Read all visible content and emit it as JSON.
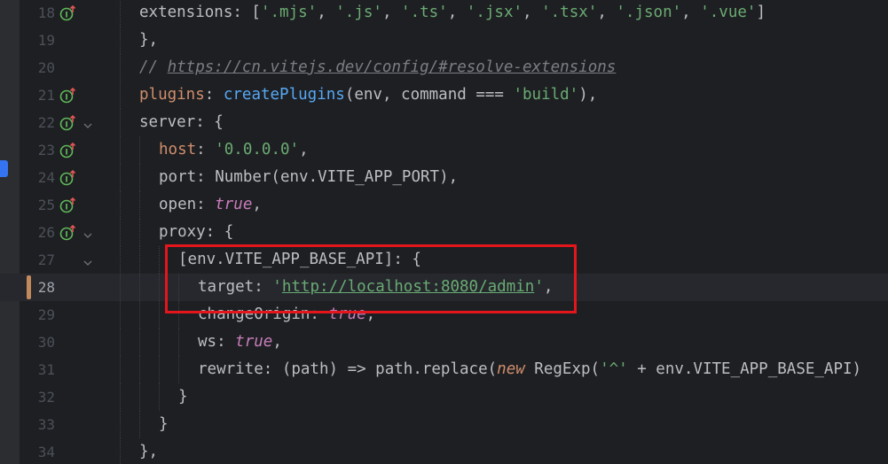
{
  "editor": {
    "lines": [
      {
        "num": "18",
        "gutter_icon": "implements-override-icon",
        "fold": false,
        "tokens": [
          {
            "t": "extensions: [",
            "c": ""
          },
          {
            "t": "'.mjs'",
            "c": "s"
          },
          {
            "t": ", ",
            "c": ""
          },
          {
            "t": "'.js'",
            "c": "s"
          },
          {
            "t": ", ",
            "c": ""
          },
          {
            "t": "'.ts'",
            "c": "s"
          },
          {
            "t": ", ",
            "c": ""
          },
          {
            "t": "'.jsx'",
            "c": "s"
          },
          {
            "t": ", ",
            "c": ""
          },
          {
            "t": "'.tsx'",
            "c": "s"
          },
          {
            "t": ", ",
            "c": ""
          },
          {
            "t": "'.json'",
            "c": "s"
          },
          {
            "t": ", ",
            "c": ""
          },
          {
            "t": "'.vue'",
            "c": "s"
          },
          {
            "t": "]",
            "c": ""
          }
        ]
      },
      {
        "num": "19",
        "gutter_icon": "",
        "fold": false,
        "tokens": [
          {
            "t": "},",
            "c": ""
          }
        ]
      },
      {
        "num": "20",
        "gutter_icon": "",
        "fold": false,
        "tokens": [
          {
            "t": "// ",
            "c": "c"
          },
          {
            "t": "https://cn.vitejs.dev/config/#resolve-extensions",
            "c": "c url"
          }
        ]
      },
      {
        "num": "21",
        "gutter_icon": "implements-override-icon",
        "fold": false,
        "tokens": [
          {
            "t": "plugins",
            "c": "k"
          },
          {
            "t": ": ",
            "c": ""
          },
          {
            "t": "createPlugins",
            "c": "fn"
          },
          {
            "t": "(env, command === ",
            "c": ""
          },
          {
            "t": "'build'",
            "c": "s"
          },
          {
            "t": "),",
            "c": ""
          }
        ]
      },
      {
        "num": "22",
        "gutter_icon": "implements-override-icon",
        "fold": true,
        "tokens": [
          {
            "t": "server: {",
            "c": ""
          }
        ]
      },
      {
        "num": "23",
        "gutter_icon": "implements-override-icon",
        "fold": false,
        "tokens": [
          {
            "t": "host",
            "c": "k"
          },
          {
            "t": ": ",
            "c": ""
          },
          {
            "t": "'0.0.0.0'",
            "c": "s"
          },
          {
            "t": ",",
            "c": ""
          }
        ]
      },
      {
        "num": "24",
        "gutter_icon": "implements-override-icon",
        "fold": false,
        "tokens": [
          {
            "t": "port: Number(env.VITE_APP_PORT),",
            "c": ""
          }
        ]
      },
      {
        "num": "25",
        "gutter_icon": "implements-override-icon",
        "fold": false,
        "tokens": [
          {
            "t": "open: ",
            "c": ""
          },
          {
            "t": "true",
            "c": "bool"
          },
          {
            "t": ",",
            "c": ""
          }
        ]
      },
      {
        "num": "26",
        "gutter_icon": "implements-override-icon",
        "fold": true,
        "tokens": [
          {
            "t": "proxy: {",
            "c": ""
          }
        ]
      },
      {
        "num": "27",
        "gutter_icon": "",
        "fold": true,
        "tokens": [
          {
            "t": "[env.VITE_APP_BASE_API]: {",
            "c": ""
          }
        ]
      },
      {
        "num": "28",
        "gutter_icon": "",
        "fold": false,
        "current": true,
        "tokens": [
          {
            "t": "target: ",
            "c": ""
          },
          {
            "t": "'",
            "c": "s"
          },
          {
            "t": "http://localhost:8080/admin",
            "c": "s url"
          },
          {
            "t": "'",
            "c": "s"
          },
          {
            "t": ",",
            "c": ""
          }
        ]
      },
      {
        "num": "29",
        "gutter_icon": "",
        "fold": false,
        "tokens": [
          {
            "t": "changeOrigin: ",
            "c": ""
          },
          {
            "t": "true",
            "c": "bool"
          },
          {
            "t": ",",
            "c": ""
          }
        ]
      },
      {
        "num": "30",
        "gutter_icon": "",
        "fold": false,
        "tokens": [
          {
            "t": "ws: ",
            "c": ""
          },
          {
            "t": "true",
            "c": "bool"
          },
          {
            "t": ",",
            "c": ""
          }
        ]
      },
      {
        "num": "31",
        "gutter_icon": "",
        "fold": false,
        "tokens": [
          {
            "t": "rewrite: (path) => path.replace(",
            "c": ""
          },
          {
            "t": "new",
            "c": "kw-i"
          },
          {
            "t": " RegExp(",
            "c": ""
          },
          {
            "t": "'^'",
            "c": "s"
          },
          {
            "t": " + env.VITE_APP_BASE_API)",
            "c": ""
          }
        ]
      },
      {
        "num": "32",
        "gutter_icon": "",
        "fold": false,
        "tokens": [
          {
            "t": "}",
            "c": ""
          }
        ]
      },
      {
        "num": "33",
        "gutter_icon": "",
        "fold": false,
        "tokens": [
          {
            "t": "}",
            "c": ""
          }
        ]
      },
      {
        "num": "34",
        "gutter_icon": "",
        "fold": false,
        "tokens": [
          {
            "t": "},",
            "c": ""
          }
        ]
      }
    ]
  },
  "colors": {
    "background": "#1e1f22",
    "keyword": "#cf8e6d",
    "string": "#6aab73",
    "function": "#56a8f5",
    "boolean": "#c77dbb",
    "comment": "#7a7e85",
    "annotation_box": "#e4161c"
  }
}
